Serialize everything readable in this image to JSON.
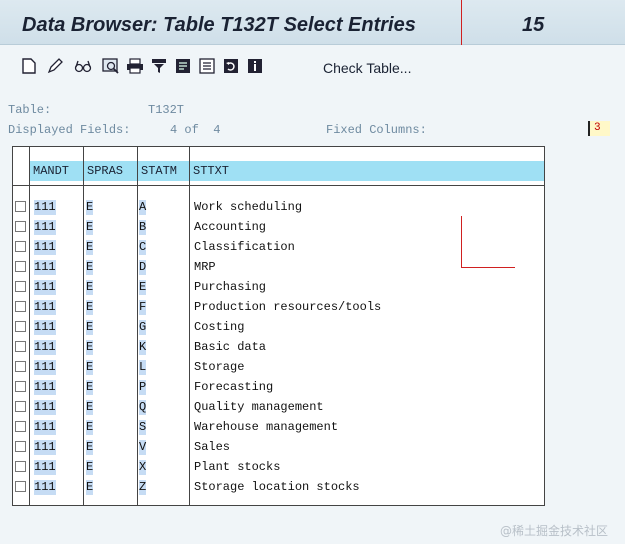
{
  "header": {
    "title": "Data Browser: Table T132T Select Entries",
    "count": "15"
  },
  "toolbar": {
    "icons": [
      "new-document-icon",
      "edit-pencil-icon",
      "glasses-icon",
      "detail-search-icon",
      "print-icon",
      "filter-icon",
      "export-icon",
      "list-icon",
      "refresh-icon",
      "info-icon"
    ],
    "check_table_label": "Check Table..."
  },
  "info": {
    "table_label": "Table:",
    "table_value": "T132T",
    "fields_label": "Displayed Fields:",
    "fields_value": "4 of  4",
    "fixed_label": "Fixed Columns:",
    "fixed_value": "3"
  },
  "grid": {
    "columns": [
      "MANDT",
      "SPRAS",
      "STATM",
      "STTXT"
    ],
    "rows": [
      {
        "mandt": "111",
        "spras": "E",
        "statm": "A",
        "sttxt": "Work scheduling"
      },
      {
        "mandt": "111",
        "spras": "E",
        "statm": "B",
        "sttxt": "Accounting"
      },
      {
        "mandt": "111",
        "spras": "E",
        "statm": "C",
        "sttxt": "Classification"
      },
      {
        "mandt": "111",
        "spras": "E",
        "statm": "D",
        "sttxt": "MRP"
      },
      {
        "mandt": "111",
        "spras": "E",
        "statm": "E",
        "sttxt": "Purchasing"
      },
      {
        "mandt": "111",
        "spras": "E",
        "statm": "F",
        "sttxt": "Production resources/tools"
      },
      {
        "mandt": "111",
        "spras": "E",
        "statm": "G",
        "sttxt": "Costing"
      },
      {
        "mandt": "111",
        "spras": "E",
        "statm": "K",
        "sttxt": "Basic data"
      },
      {
        "mandt": "111",
        "spras": "E",
        "statm": "L",
        "sttxt": "Storage"
      },
      {
        "mandt": "111",
        "spras": "E",
        "statm": "P",
        "sttxt": "Forecasting"
      },
      {
        "mandt": "111",
        "spras": "E",
        "statm": "Q",
        "sttxt": "Quality management"
      },
      {
        "mandt": "111",
        "spras": "E",
        "statm": "S",
        "sttxt": "Warehouse management"
      },
      {
        "mandt": "111",
        "spras": "E",
        "statm": "V",
        "sttxt": "Sales"
      },
      {
        "mandt": "111",
        "spras": "E",
        "statm": "X",
        "sttxt": "Plant stocks"
      },
      {
        "mandt": "111",
        "spras": "E",
        "statm": "Z",
        "sttxt": "Storage location stocks"
      }
    ]
  },
  "colors": {
    "header_bg": "#9fe0f4",
    "key_cell_bg": "#c6dcf4",
    "marker": "#d02020"
  },
  "watermark": "@稀土掘金技术社区"
}
